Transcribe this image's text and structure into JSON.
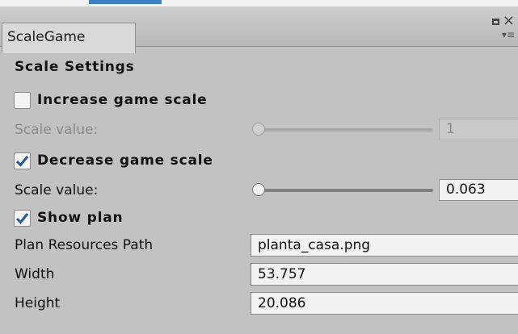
{
  "window": {
    "tab_title": "ScaleGame",
    "close_glyph": "×",
    "menu_glyph": "▾≡"
  },
  "section": {
    "title": "Scale Settings"
  },
  "increase": {
    "label": "Increase game scale",
    "checked": false,
    "scale_label": "Scale value:",
    "scale_value": "1",
    "enabled": false
  },
  "decrease": {
    "label": "Decrease game scale",
    "checked": true,
    "scale_label": "Scale value:",
    "scale_value": "0.063",
    "enabled": true
  },
  "plan": {
    "label": "Show plan",
    "checked": true,
    "path_label": "Plan Resources Path",
    "path_value": "planta_casa.png",
    "width_label": "Width",
    "width_value": "53.757",
    "height_label": "Height",
    "height_value": "20.086"
  },
  "colors": {
    "panel_bg": "#c2c2c2",
    "field_bg": "#f2f2f2",
    "accent": "#3d7fc4"
  }
}
